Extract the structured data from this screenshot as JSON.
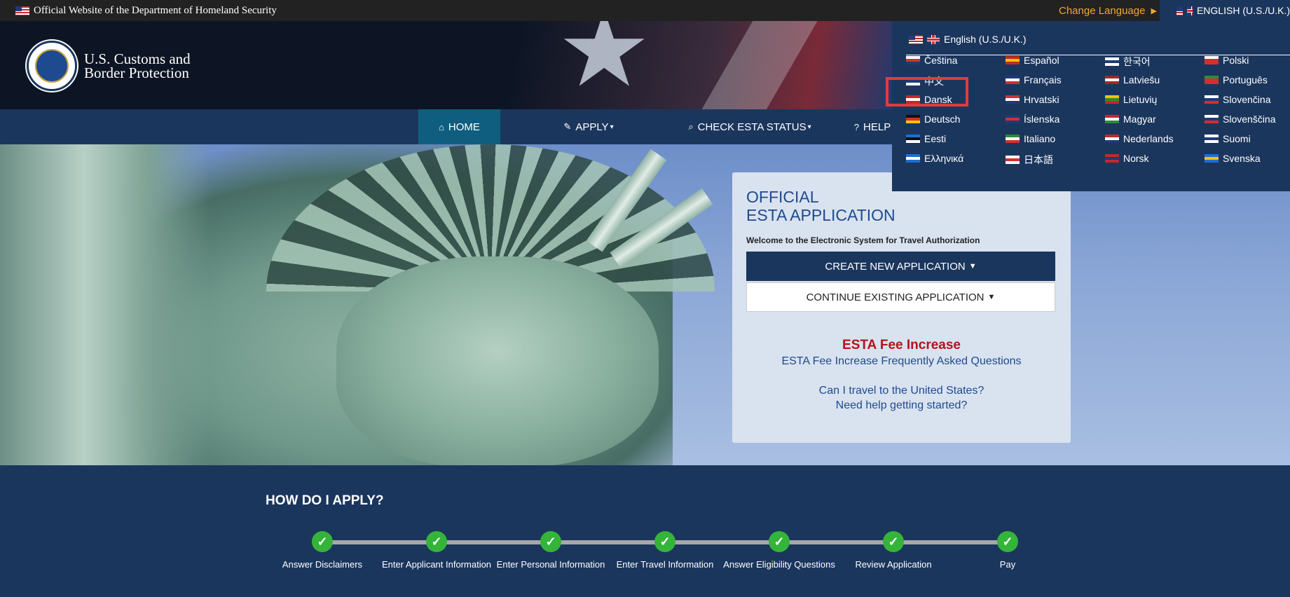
{
  "topbar": {
    "official": "Official Website of the Department of Homeland Security",
    "change_language": "Change Language",
    "current_language": "ENGLISH (U.S./U.K.)"
  },
  "header": {
    "agency_line1": "U.S. Customs and",
    "agency_line2": "Border Protection"
  },
  "nav": {
    "home": "HOME",
    "apply": "APPLY",
    "check_status": "CHECK ESTA STATUS",
    "help": "HELP"
  },
  "card": {
    "title_line1": "OFFICIAL",
    "title_line2": "ESTA APPLICATION",
    "welcome": "Welcome to the Electronic System for Travel Authorization",
    "create_button": "CREATE NEW APPLICATION",
    "continue_button": "CONTINUE EXISTING APPLICATION",
    "fee_title": "ESTA Fee Increase",
    "fee_link": "ESTA Fee Increase Frequently Asked Questions",
    "question1": "Can I travel to the United States?",
    "question2": "Need help getting started?"
  },
  "language_menu": {
    "current": "English (U.S./U.K.)",
    "languages": [
      {
        "label": "Čeština",
        "colors": [
          "#ffffff",
          "#d32f2f",
          "#1e3a78"
        ]
      },
      {
        "label": "中文",
        "colors": [
          "#d32f2f",
          "#1e3a78",
          "#ffffff"
        ]
      },
      {
        "label": "Dansk",
        "colors": [
          "#c62828",
          "#ffffff",
          "#c62828"
        ]
      },
      {
        "label": "Deutsch",
        "colors": [
          "#111111",
          "#d32f2f",
          "#f5c400"
        ]
      },
      {
        "label": "Eesti",
        "colors": [
          "#1e6fd0",
          "#111111",
          "#ffffff"
        ]
      },
      {
        "label": "Ελληνικά",
        "colors": [
          "#1e6fd0",
          "#ffffff",
          "#1e6fd0"
        ]
      },
      {
        "label": "Español",
        "colors": [
          "#c62828",
          "#f5c400",
          "#c62828"
        ]
      },
      {
        "label": "Français",
        "colors": [
          "#1e3a78",
          "#ffffff",
          "#d32f2f"
        ]
      },
      {
        "label": "Hrvatski",
        "colors": [
          "#d32f2f",
          "#ffffff",
          "#1e3a78"
        ]
      },
      {
        "label": "Íslenska",
        "colors": [
          "#1e3a78",
          "#d32f2f",
          "#1e3a78"
        ]
      },
      {
        "label": "Italiano",
        "colors": [
          "#2e8b3a",
          "#ffffff",
          "#d32f2f"
        ]
      },
      {
        "label": "日本語",
        "colors": [
          "#ffffff",
          "#d32f2f",
          "#ffffff"
        ]
      },
      {
        "label": "한국어",
        "colors": [
          "#ffffff",
          "#1e3a78",
          "#ffffff"
        ]
      },
      {
        "label": "Latviešu",
        "colors": [
          "#9e2a2b",
          "#ffffff",
          "#9e2a2b"
        ]
      },
      {
        "label": "Lietuvių",
        "colors": [
          "#f5c400",
          "#2e8b3a",
          "#c62828"
        ]
      },
      {
        "label": "Magyar",
        "colors": [
          "#c62828",
          "#ffffff",
          "#2e8b3a"
        ]
      },
      {
        "label": "Nederlands",
        "colors": [
          "#c62828",
          "#ffffff",
          "#1e3a78"
        ]
      },
      {
        "label": "Norsk",
        "colors": [
          "#c62828",
          "#1e3a78",
          "#c62828"
        ]
      },
      {
        "label": "Polski",
        "colors": [
          "#ffffff",
          "#d32f2f",
          "#d32f2f"
        ]
      },
      {
        "label": "Português",
        "colors": [
          "#2e8b3a",
          "#d32f2f",
          "#d32f2f"
        ]
      },
      {
        "label": "Slovenčina",
        "colors": [
          "#ffffff",
          "#1e3a78",
          "#d32f2f"
        ]
      },
      {
        "label": "Slovenščina",
        "colors": [
          "#ffffff",
          "#1e3a78",
          "#d32f2f"
        ]
      },
      {
        "label": "Suomi",
        "colors": [
          "#ffffff",
          "#1e3a78",
          "#ffffff"
        ]
      },
      {
        "label": "Svenska",
        "colors": [
          "#1e6fd0",
          "#f5c400",
          "#1e6fd0"
        ]
      }
    ]
  },
  "how_to_apply": {
    "title": "HOW DO I APPLY?",
    "steps": [
      {
        "label": "Answer Disclaimers"
      },
      {
        "label": "Enter Applicant Information"
      },
      {
        "label": "Enter Personal Information"
      },
      {
        "label": "Enter Travel Information"
      },
      {
        "label": "Answer Eligibility Questions"
      },
      {
        "label": "Review Application"
      },
      {
        "label": "Pay"
      }
    ]
  },
  "colors": {
    "navy": "#1b365d",
    "active_tab": "#0f5e80",
    "accent_link": "#1e4b8f",
    "alert_red": "#b2131d",
    "change_language": "#f0a830",
    "check_green": "#35b43a",
    "highlight_box": "#e23b3b"
  }
}
